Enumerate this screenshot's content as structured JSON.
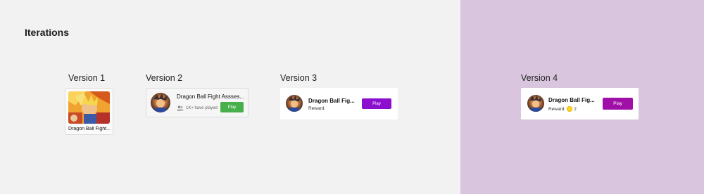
{
  "page": {
    "title": "Iterations",
    "accent_purple": "#8c0fd0",
    "accent_green": "#47b04b",
    "panel_color": "#d9c6de"
  },
  "versions": [
    {
      "label": "Version 1",
      "game_name": "Dragon Ball Fight..."
    },
    {
      "label": "Version 2",
      "game_name": "Dragon Ball Fight Assses...",
      "players_icon": "users-icon",
      "players_text": "1K+ have played",
      "play_label": "Play"
    },
    {
      "label": "Version 3",
      "game_name": "Dragon Ball Fig...",
      "reward_label": "Reward:",
      "play_label": "Play"
    },
    {
      "label": "Version 4",
      "game_name": "Dragon Ball Fig...",
      "reward_label": "Reward:",
      "reward_icon": "coin-icon",
      "reward_value": "2",
      "play_label": "Play"
    }
  ]
}
